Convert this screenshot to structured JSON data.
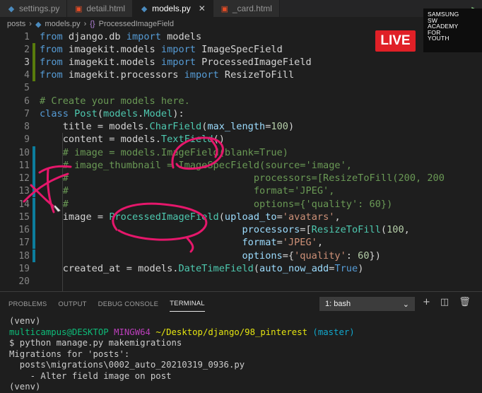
{
  "tabs": [
    {
      "name": "settings.py",
      "type": "py",
      "active": false
    },
    {
      "name": "detail.html",
      "type": "html",
      "active": false
    },
    {
      "name": "models.py",
      "type": "py",
      "active": true
    },
    {
      "name": "_card.html",
      "type": "html",
      "active": false
    }
  ],
  "breadcrumb": {
    "folder": "posts",
    "file": "models.py",
    "symbol": "ProcessedImageField"
  },
  "overlay": {
    "live": "LIVE",
    "brand_lines": [
      "SAMSUNG",
      "SW",
      "ACADEMY",
      "FOR",
      "YOUTH"
    ]
  },
  "editor": {
    "line_numbers": [
      "1",
      "2",
      "3",
      "4",
      "5",
      "6",
      "7",
      "8",
      "9",
      "10",
      "11",
      "12",
      "13",
      "14",
      "15",
      "16",
      "17",
      "18",
      "19",
      "20"
    ],
    "code": {
      "l1": {
        "kw1": "from",
        "mod": " django.db ",
        "kw2": "import",
        "name": " models"
      },
      "l2": {
        "kw1": "from",
        "mod": " imagekit.models ",
        "kw2": "import",
        "name": " ImageSpecField"
      },
      "l3": {
        "kw1": "from",
        "mod": " imagekit.models ",
        "kw2": "import",
        "name": " ProcessedImageField"
      },
      "l4": {
        "kw1": "from",
        "mod": " imagekit.processors ",
        "kw2": "import",
        "name": " ResizeToFill"
      },
      "l6": {
        "comment": "# Create your models here."
      },
      "l7": {
        "kw": "class",
        "cls": "Post",
        "base1": "models",
        "base2": "Model",
        "tail": "):"
      },
      "l8": {
        "a": "title = models.",
        "fn": "CharField",
        "param": "max_length",
        "num": "100"
      },
      "l9": {
        "a": "content = models.",
        "fn": "TextField",
        "tail": "()"
      },
      "l10": {
        "comment": "# image = models.ImageField(blank=True)"
      },
      "l11": {
        "comment": "# image_thumbnail = ImageSpecField(source='image',"
      },
      "l12": {
        "hash": "#",
        "comment": "processors=[ResizeToFill(200, 200"
      },
      "l13": {
        "hash": "#",
        "comment": "format='JPEG',"
      },
      "l14": {
        "hash": "#",
        "comment": "options={'quality': 60})"
      },
      "l15": {
        "a": "image = ",
        "fn": "ProcessedImageField",
        "param": "upload_to",
        "str": "'avatars'"
      },
      "l16": {
        "param": "processors",
        "fn": "ResizeToFill",
        "num": "100"
      },
      "l17": {
        "param": "format",
        "str": "'JPEG'"
      },
      "l18": {
        "param": "options",
        "str": "'quality'",
        "num": "60"
      },
      "l19": {
        "a": "created_at = models.",
        "fn": "DateTimeField",
        "param": "auto_now_add",
        "kw": "True"
      }
    }
  },
  "panel": {
    "tabs": [
      "PROBLEMS",
      "OUTPUT",
      "DEBUG CONSOLE",
      "TERMINAL"
    ],
    "active_tab": "TERMINAL",
    "terminal_select": "1: bash",
    "terminal": {
      "l1": "(venv)",
      "user": "multicampus@DESKTOP",
      "shell": "MINGW64",
      "path": "~/Desktop/django/98_pinterest",
      "branch": "(master)",
      "l3": "$ python manage.py makemigrations",
      "l4": "Migrations for 'posts':",
      "l5": "  posts\\migrations\\0002_auto_20210319_0936.py",
      "l6": "    - Alter field image on post",
      "l7": "(venv)"
    }
  },
  "colors": {
    "accent_live": "#e02027",
    "keyword": "#569cd6",
    "type": "#4ec9b0",
    "function": "#dcdcaa",
    "string": "#ce9178",
    "comment": "#6a9955",
    "annotation": "#e5176b"
  }
}
